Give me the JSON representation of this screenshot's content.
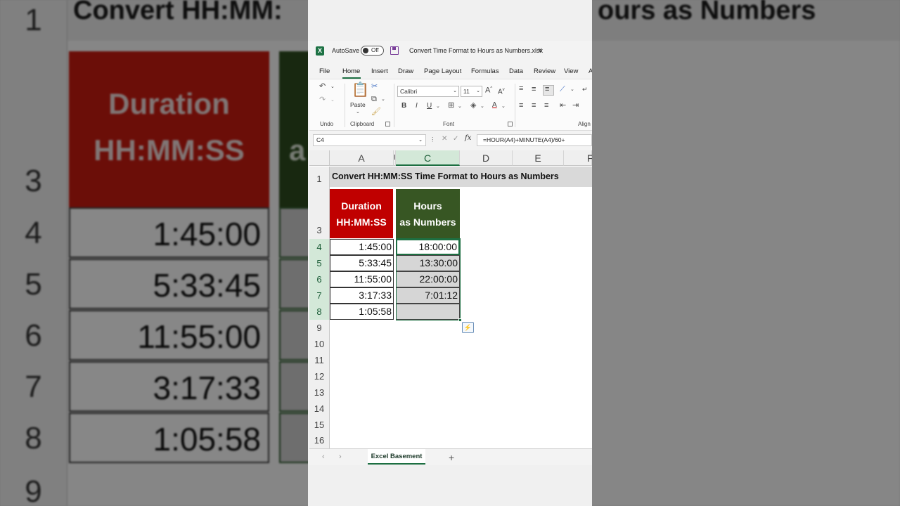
{
  "app": {
    "autosave_label": "AutoSave",
    "autosave_state": "Off",
    "file_name": "Convert Time Format to Hours as Numbers.xlsx",
    "file_chevron": "∨",
    "logo_letter": "X"
  },
  "ribbon_tabs": [
    "File",
    "Home",
    "Insert",
    "Draw",
    "Page Layout",
    "Formulas",
    "Data",
    "Review",
    "View",
    "A"
  ],
  "active_tab": "Home",
  "ribbon": {
    "undo_group_label": "Undo",
    "clipboard_group_label": "Clipboard",
    "font_group_label": "Font",
    "align_group_label": "Align",
    "paste_label": "Paste",
    "font_name": "Calibri",
    "font_size": "11",
    "bold": "B",
    "italic": "I",
    "underline": "U",
    "font_color": "A"
  },
  "formula_bar": {
    "name_box": "C4",
    "fx_label": "fx",
    "formula": "=HOUR(A4)+MINUTE(A4)/60+"
  },
  "columns": [
    "A",
    "B",
    "C",
    "D",
    "E",
    "F"
  ],
  "rows": [
    "1",
    "3",
    "4",
    "5",
    "6",
    "7",
    "8",
    "9",
    "10",
    "11",
    "12",
    "13",
    "14",
    "15",
    "16"
  ],
  "sheet": {
    "title": "Convert HH:MM:SS Time Format to Hours as Numbers",
    "header_a_line1": "Duration",
    "header_a_line2": "HH:MM:SS",
    "header_c_line1": "Hours",
    "header_c_line2": "as Numbers",
    "duration": [
      "1:45:00",
      "5:33:45",
      "11:55:00",
      "3:17:33",
      "1:05:58"
    ],
    "hours": [
      "18:00:00",
      "13:30:00",
      "22:00:00",
      "7:01:12",
      ""
    ]
  },
  "sheet_tabs": {
    "active": "Excel Basement",
    "add": "+",
    "prev": "‹",
    "next": "›"
  },
  "background": {
    "title_left": "Convert HH:MM:",
    "title_right": "ours as Numbers",
    "row_numbers": [
      "1",
      "3",
      "4",
      "5",
      "6",
      "7",
      "8",
      "9"
    ],
    "header_line1": "Duration",
    "header_line2": "HH:MM:SS",
    "green_fragment": "a",
    "values": [
      "1:45:00",
      "5:33:45",
      "11:55:00",
      "3:17:33",
      "1:05:58"
    ]
  },
  "colors": {
    "excel_green": "#1d6f42",
    "header_red": "#c00000",
    "header_green": "#375623",
    "selection_fill": "#d6d6d6"
  }
}
